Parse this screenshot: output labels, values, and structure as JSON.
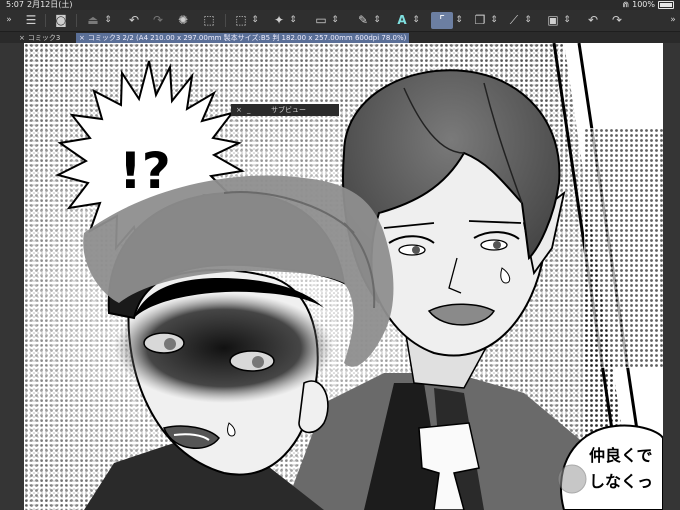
{
  "status_bar": {
    "time": "5:07",
    "date": "2月12日(土)",
    "battery": "100%"
  },
  "toolbar": {
    "menu_icon": "menu-icon",
    "undo_icon": "undo-icon",
    "redo_icon": "redo-icon"
  },
  "tabs": [
    {
      "label": "コミック3"
    },
    {
      "label": "コミック3 2/2 (A4 210.00 x 297.00mm 製本サイズ:B5 判 182.00 x 257.00mm 600dpi 78.0%)"
    }
  ],
  "subview": {
    "close": "×",
    "title": "サブビュー"
  },
  "comic": {
    "shout": "!?",
    "bubble_lines": [
      "仲良くで",
      "しなくっ"
    ]
  },
  "colors": {
    "toolbar_bg": "#2f2f2f",
    "tab_active": "#5a6f97",
    "selected_tool": "#6c7fa2"
  }
}
